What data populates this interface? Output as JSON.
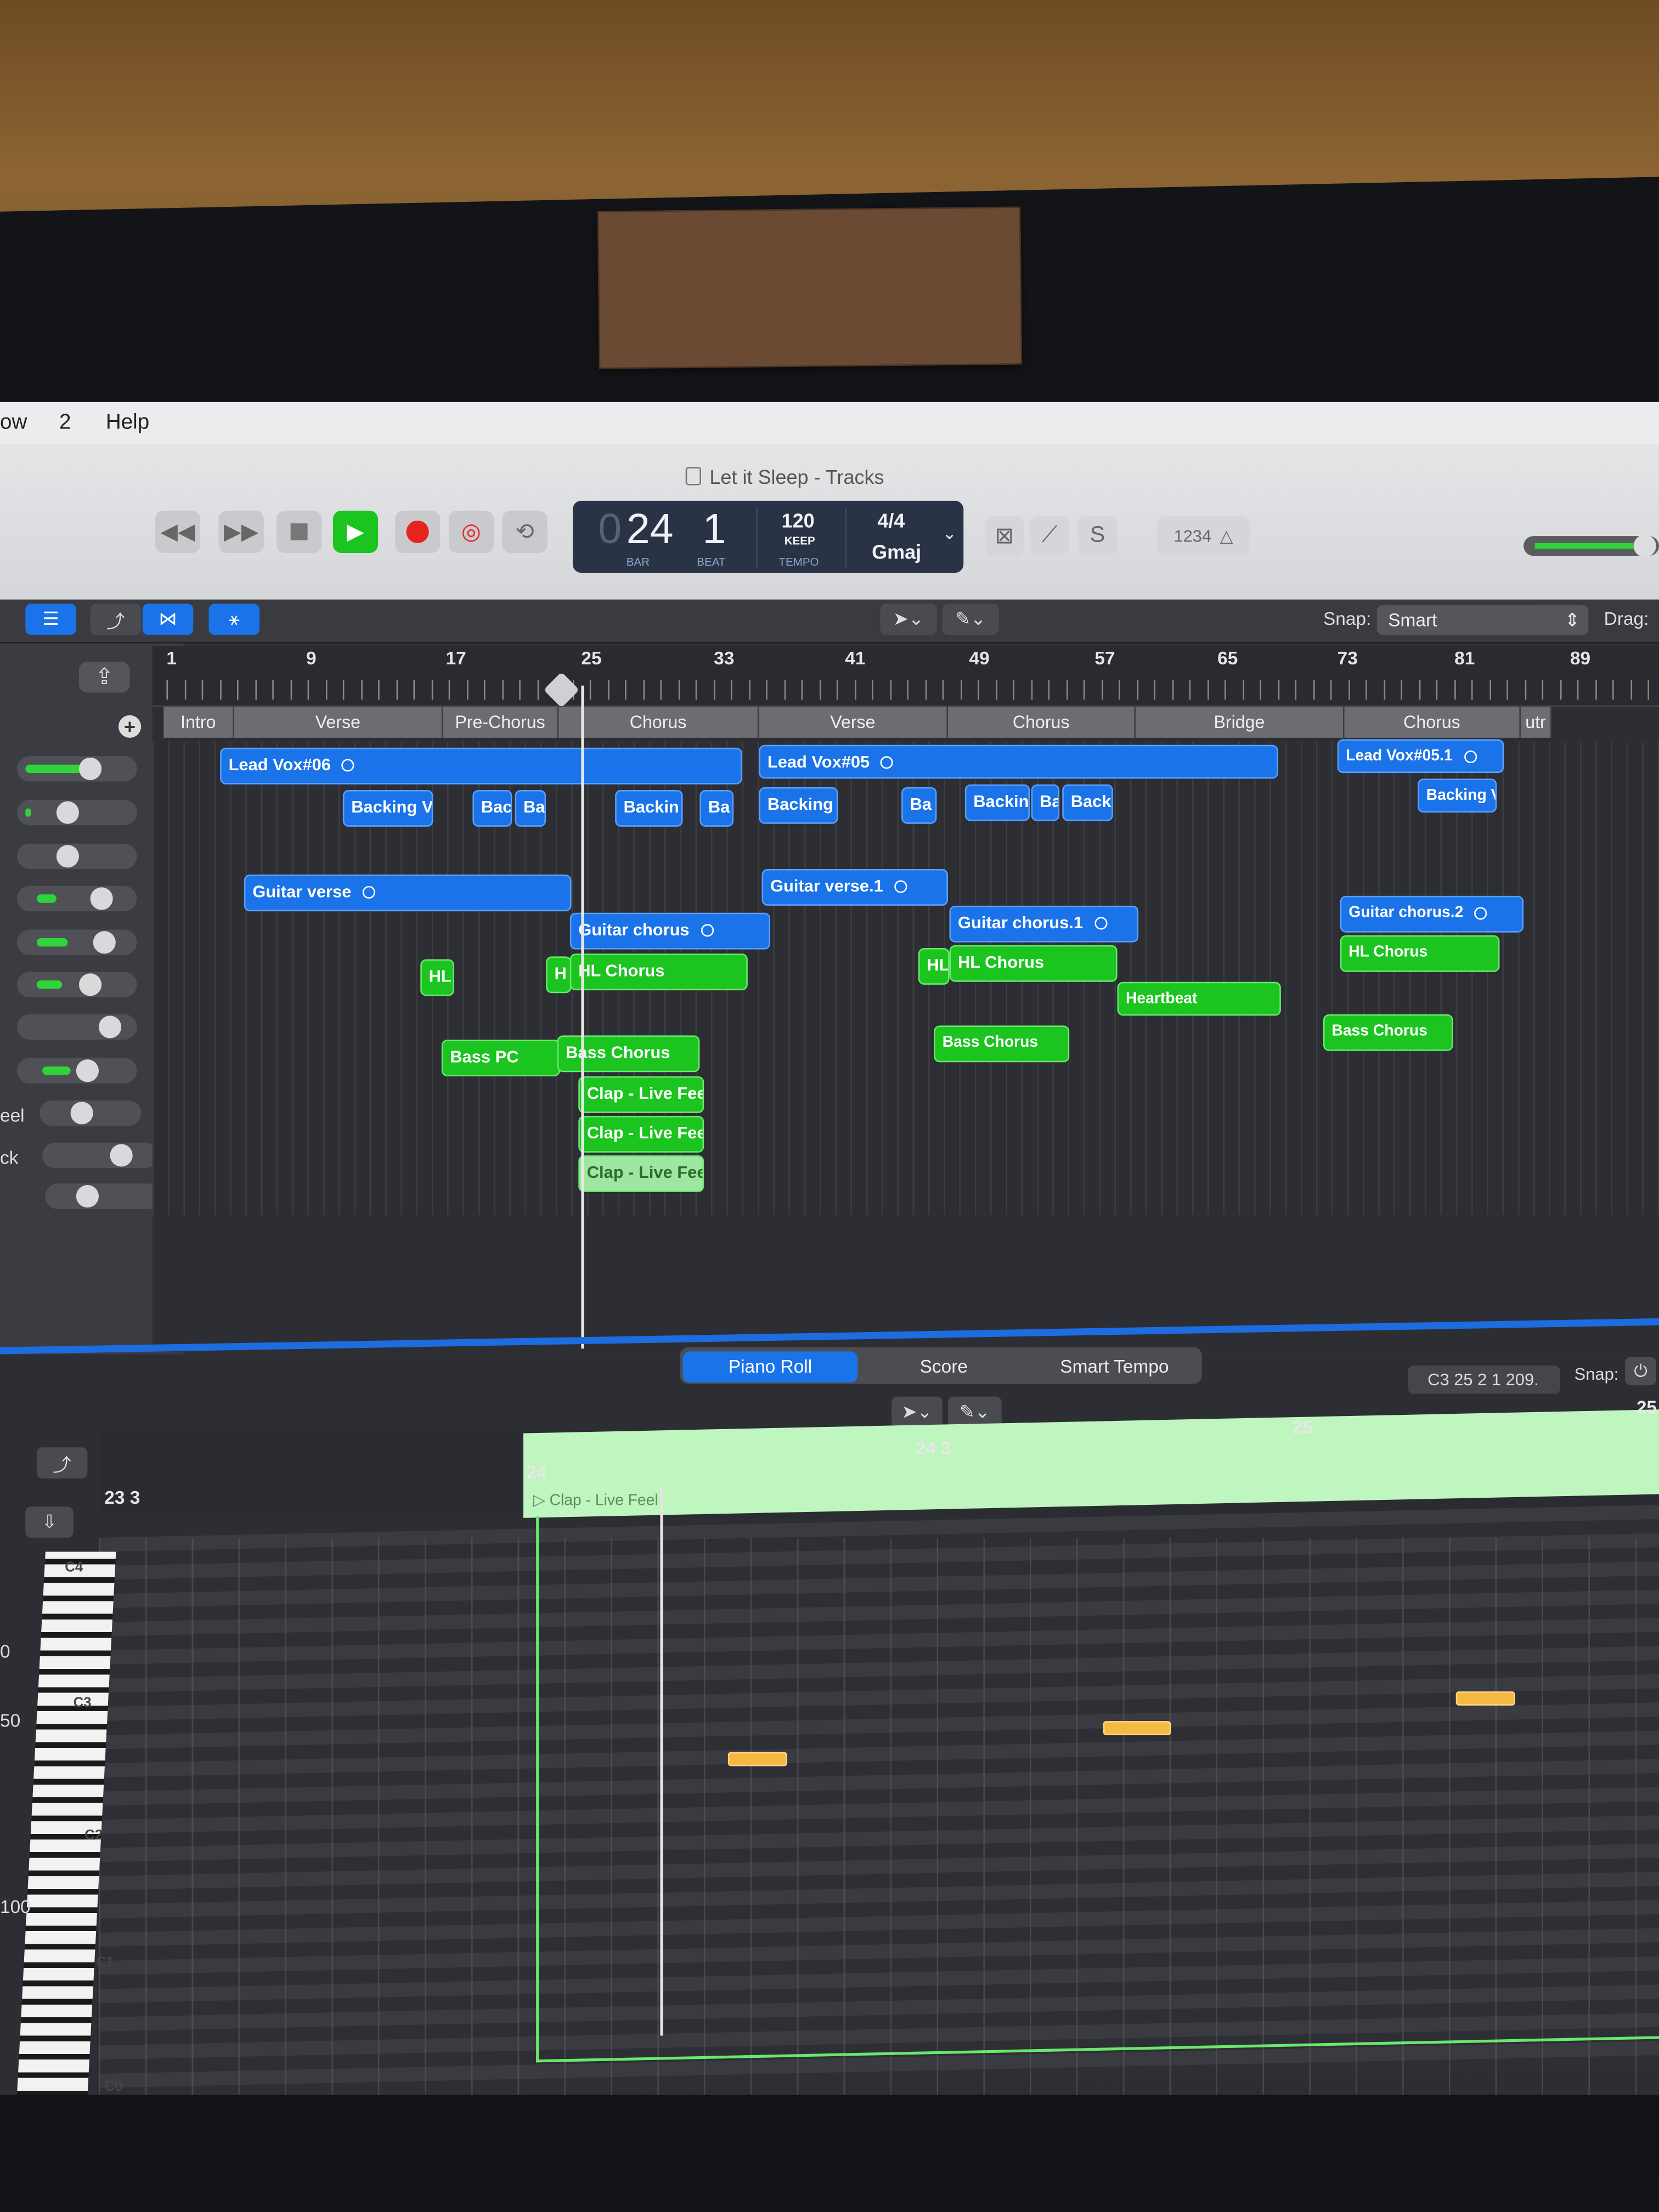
{
  "menubar": {
    "items": [
      "ow",
      "2",
      "Help"
    ]
  },
  "window": {
    "title": "Let it Sleep - Tracks"
  },
  "lcd": {
    "bar_dim": "0",
    "bar": "24",
    "beat": "1",
    "bar_label": "BAR",
    "beat_label": "BEAT",
    "tempo": "120",
    "tempo_mode": "KEEP",
    "tempo_label": "TEMPO",
    "signature": "4/4",
    "key": "Gmaj"
  },
  "toolbar": {
    "count_in": "1234",
    "snap_label": "Snap:",
    "snap_value": "Smart",
    "drag_label": "Drag:"
  },
  "ruler": {
    "bars": [
      "1",
      "9",
      "17",
      "25",
      "33",
      "41",
      "49",
      "57",
      "65",
      "73",
      "81",
      "89"
    ]
  },
  "markers": [
    "Intro",
    "Verse",
    "Pre-Chorus",
    "Chorus",
    "Verse",
    "Chorus",
    "Bridge",
    "Chorus",
    "utr"
  ],
  "track_names": [
    "eel",
    "ck"
  ],
  "regions": [
    "Lead Vox#06",
    "Lead Vox#05",
    "Lead Vox#05.1",
    "Backing V",
    "Bac",
    "Ba",
    "Backin",
    "Ba",
    "Backing",
    "Ba",
    "Backin",
    "Ba",
    "Backi",
    "Backing V",
    "Guitar verse",
    "Guitar verse.1",
    "Guitar chorus",
    "Guitar chorus.1",
    "Guitar chorus.2",
    "HL",
    "H",
    "HL Chorus",
    "HL",
    "HL Chorus",
    "HL Chorus",
    "Heartbeat",
    "Bass PC",
    "Bass Chorus",
    "Bass Chorus",
    "Bass Chorus",
    "Clap - Live Feel",
    "Clap - Live Feel",
    "Clap - Live Feel"
  ],
  "editor": {
    "tabs": [
      "Piano Roll",
      "Score",
      "Smart Tempo"
    ],
    "position_readout": "C3   25 2 1 209.",
    "snap_label": "Snap:",
    "ruler": [
      "23 3",
      "24",
      "24 3",
      "25",
      "25"
    ],
    "region_label": "Clap - Live Feel",
    "keys": [
      "C4",
      "C3",
      "C2",
      "C1",
      "C0"
    ],
    "side_values": [
      "0",
      "50",
      "100"
    ]
  },
  "colors": {
    "accent": "#1a73e8",
    "audio_region": "#1a73e8",
    "midi_region": "#1bc41f",
    "note": "#f5b941",
    "play": "#1bc41f",
    "record": "#e8221e"
  }
}
